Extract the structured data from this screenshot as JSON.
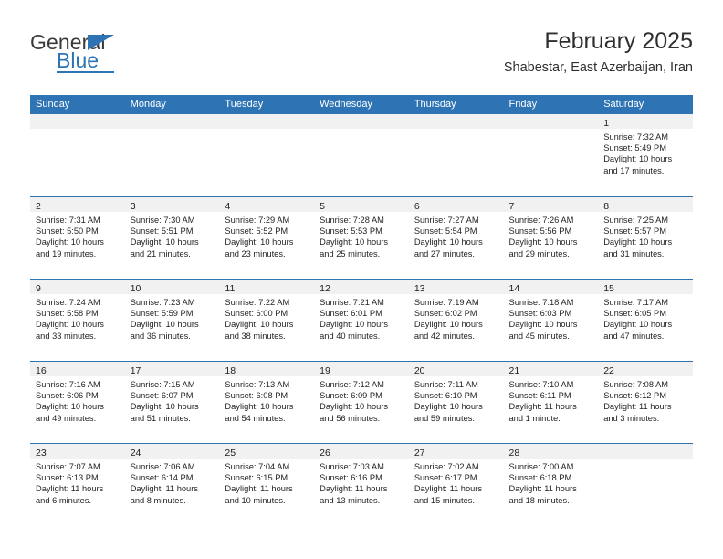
{
  "brand": {
    "name_top": "General",
    "name_bottom": "Blue",
    "accent_color": "#2E74B5"
  },
  "header": {
    "month_title": "February 2025",
    "location": "Shabestar, East Azerbaijan, Iran"
  },
  "calendar": {
    "weekday_headers": [
      "Sunday",
      "Monday",
      "Tuesday",
      "Wednesday",
      "Thursday",
      "Friday",
      "Saturday"
    ],
    "header_bg": "#2E74B5",
    "daynum_band_bg": "#F1F1F1",
    "weeks": [
      [
        {
          "day": "",
          "lines": []
        },
        {
          "day": "",
          "lines": []
        },
        {
          "day": "",
          "lines": []
        },
        {
          "day": "",
          "lines": []
        },
        {
          "day": "",
          "lines": []
        },
        {
          "day": "",
          "lines": []
        },
        {
          "day": "1",
          "lines": [
            "Sunrise: 7:32 AM",
            "Sunset: 5:49 PM",
            "Daylight: 10 hours",
            "and 17 minutes."
          ]
        }
      ],
      [
        {
          "day": "2",
          "lines": [
            "Sunrise: 7:31 AM",
            "Sunset: 5:50 PM",
            "Daylight: 10 hours",
            "and 19 minutes."
          ]
        },
        {
          "day": "3",
          "lines": [
            "Sunrise: 7:30 AM",
            "Sunset: 5:51 PM",
            "Daylight: 10 hours",
            "and 21 minutes."
          ]
        },
        {
          "day": "4",
          "lines": [
            "Sunrise: 7:29 AM",
            "Sunset: 5:52 PM",
            "Daylight: 10 hours",
            "and 23 minutes."
          ]
        },
        {
          "day": "5",
          "lines": [
            "Sunrise: 7:28 AM",
            "Sunset: 5:53 PM",
            "Daylight: 10 hours",
            "and 25 minutes."
          ]
        },
        {
          "day": "6",
          "lines": [
            "Sunrise: 7:27 AM",
            "Sunset: 5:54 PM",
            "Daylight: 10 hours",
            "and 27 minutes."
          ]
        },
        {
          "day": "7",
          "lines": [
            "Sunrise: 7:26 AM",
            "Sunset: 5:56 PM",
            "Daylight: 10 hours",
            "and 29 minutes."
          ]
        },
        {
          "day": "8",
          "lines": [
            "Sunrise: 7:25 AM",
            "Sunset: 5:57 PM",
            "Daylight: 10 hours",
            "and 31 minutes."
          ]
        }
      ],
      [
        {
          "day": "9",
          "lines": [
            "Sunrise: 7:24 AM",
            "Sunset: 5:58 PM",
            "Daylight: 10 hours",
            "and 33 minutes."
          ]
        },
        {
          "day": "10",
          "lines": [
            "Sunrise: 7:23 AM",
            "Sunset: 5:59 PM",
            "Daylight: 10 hours",
            "and 36 minutes."
          ]
        },
        {
          "day": "11",
          "lines": [
            "Sunrise: 7:22 AM",
            "Sunset: 6:00 PM",
            "Daylight: 10 hours",
            "and 38 minutes."
          ]
        },
        {
          "day": "12",
          "lines": [
            "Sunrise: 7:21 AM",
            "Sunset: 6:01 PM",
            "Daylight: 10 hours",
            "and 40 minutes."
          ]
        },
        {
          "day": "13",
          "lines": [
            "Sunrise: 7:19 AM",
            "Sunset: 6:02 PM",
            "Daylight: 10 hours",
            "and 42 minutes."
          ]
        },
        {
          "day": "14",
          "lines": [
            "Sunrise: 7:18 AM",
            "Sunset: 6:03 PM",
            "Daylight: 10 hours",
            "and 45 minutes."
          ]
        },
        {
          "day": "15",
          "lines": [
            "Sunrise: 7:17 AM",
            "Sunset: 6:05 PM",
            "Daylight: 10 hours",
            "and 47 minutes."
          ]
        }
      ],
      [
        {
          "day": "16",
          "lines": [
            "Sunrise: 7:16 AM",
            "Sunset: 6:06 PM",
            "Daylight: 10 hours",
            "and 49 minutes."
          ]
        },
        {
          "day": "17",
          "lines": [
            "Sunrise: 7:15 AM",
            "Sunset: 6:07 PM",
            "Daylight: 10 hours",
            "and 51 minutes."
          ]
        },
        {
          "day": "18",
          "lines": [
            "Sunrise: 7:13 AM",
            "Sunset: 6:08 PM",
            "Daylight: 10 hours",
            "and 54 minutes."
          ]
        },
        {
          "day": "19",
          "lines": [
            "Sunrise: 7:12 AM",
            "Sunset: 6:09 PM",
            "Daylight: 10 hours",
            "and 56 minutes."
          ]
        },
        {
          "day": "20",
          "lines": [
            "Sunrise: 7:11 AM",
            "Sunset: 6:10 PM",
            "Daylight: 10 hours",
            "and 59 minutes."
          ]
        },
        {
          "day": "21",
          "lines": [
            "Sunrise: 7:10 AM",
            "Sunset: 6:11 PM",
            "Daylight: 11 hours",
            "and 1 minute."
          ]
        },
        {
          "day": "22",
          "lines": [
            "Sunrise: 7:08 AM",
            "Sunset: 6:12 PM",
            "Daylight: 11 hours",
            "and 3 minutes."
          ]
        }
      ],
      [
        {
          "day": "23",
          "lines": [
            "Sunrise: 7:07 AM",
            "Sunset: 6:13 PM",
            "Daylight: 11 hours",
            "and 6 minutes."
          ]
        },
        {
          "day": "24",
          "lines": [
            "Sunrise: 7:06 AM",
            "Sunset: 6:14 PM",
            "Daylight: 11 hours",
            "and 8 minutes."
          ]
        },
        {
          "day": "25",
          "lines": [
            "Sunrise: 7:04 AM",
            "Sunset: 6:15 PM",
            "Daylight: 11 hours",
            "and 10 minutes."
          ]
        },
        {
          "day": "26",
          "lines": [
            "Sunrise: 7:03 AM",
            "Sunset: 6:16 PM",
            "Daylight: 11 hours",
            "and 13 minutes."
          ]
        },
        {
          "day": "27",
          "lines": [
            "Sunrise: 7:02 AM",
            "Sunset: 6:17 PM",
            "Daylight: 11 hours",
            "and 15 minutes."
          ]
        },
        {
          "day": "28",
          "lines": [
            "Sunrise: 7:00 AM",
            "Sunset: 6:18 PM",
            "Daylight: 11 hours",
            "and 18 minutes."
          ]
        },
        {
          "day": "",
          "lines": []
        }
      ]
    ]
  }
}
